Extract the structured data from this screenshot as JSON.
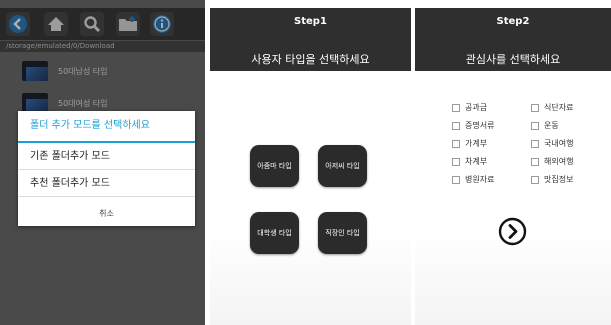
{
  "file_browser": {
    "toolbar_icons": [
      "back-icon",
      "home-icon",
      "search-icon",
      "new-folder-icon",
      "info-icon"
    ],
    "path": "/storage/emulated/0/Download",
    "files": [
      {
        "name": "50대남성 타입"
      },
      {
        "name": "50대여성 타입"
      }
    ],
    "dialog": {
      "title": "폴더 추가 모드를 선택하세요",
      "options": [
        "기존 폴더추가 모드",
        "추천 폴더추가 모드"
      ],
      "cancel": "취소"
    }
  },
  "step1": {
    "title": "Step1",
    "subtitle": "사용자 타입을 선택하세요",
    "types": [
      "아줌마 타입",
      "아저씨 타입",
      "대학생 타입",
      "직장인 타입"
    ]
  },
  "step2": {
    "title": "Step2",
    "subtitle": "관심사를 선택하세요",
    "interests_left": [
      "공과금",
      "증명서류",
      "가계부",
      "차계부",
      "병원자료"
    ],
    "interests_right": [
      "식단자료",
      "운동",
      "국내여행",
      "해외여행",
      "맛집정보"
    ],
    "next_icon": "chevron-right-circle-icon"
  },
  "colors": {
    "accent": "#1aa0d6",
    "header_bg": "#2f2f2f",
    "type_button_bg": "#2b2b2b"
  }
}
